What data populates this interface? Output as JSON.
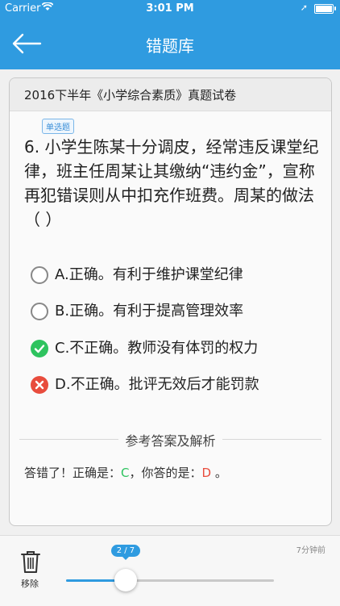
{
  "status_bar": {
    "carrier": "Carrier",
    "time": "3:01 PM"
  },
  "nav": {
    "title": "错题库"
  },
  "paper": {
    "title": "2016下半年《小学综合素质》真题试卷"
  },
  "question": {
    "type_badge": "单选题",
    "text": "6. 小学生陈某十分调皮，经常违反课堂纪律，班主任周某让其缴纳“违约金”，宣称再犯错误则从中扣充作班费。周某的做法（ ）",
    "options": [
      {
        "label": "A.正确。有利于维护课堂纪律",
        "state": "none"
      },
      {
        "label": "B.正确。有利于提高管理效率",
        "state": "none"
      },
      {
        "label": "C.不正确。教师没有体罚的权力",
        "state": "correct"
      },
      {
        "label": "D.不正确。批评无效后才能罚款",
        "state": "wrong"
      }
    ]
  },
  "analysis": {
    "section_title": "参考答案及解析",
    "prefix": "答错了！正确是：",
    "correct": "C",
    "mid": "，你答的是：",
    "yours": "D",
    "suffix": " 。"
  },
  "bottom": {
    "delete_label": "移除",
    "time_ago": "7分钟前",
    "progress_label": "2 / 7",
    "progress_fraction": 0.2857
  },
  "colors": {
    "accent": "#2f9be0",
    "correct": "#2ec35f",
    "wrong": "#e84c3d"
  }
}
